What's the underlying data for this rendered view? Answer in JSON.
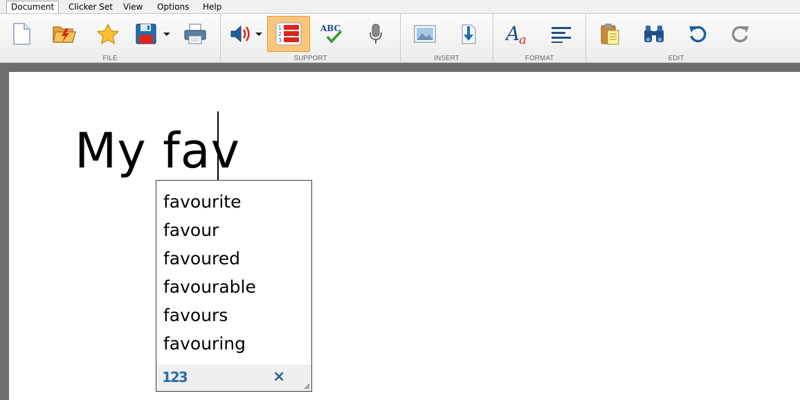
{
  "menu": {
    "tabs": [
      {
        "label": "Document"
      },
      {
        "label": "Clicker Set"
      },
      {
        "label": "View"
      },
      {
        "label": "Options"
      },
      {
        "label": "Help"
      }
    ]
  },
  "ribbon": {
    "groups": [
      {
        "label": "FILE"
      },
      {
        "label": "SUPPORT"
      },
      {
        "label": "INSERT"
      },
      {
        "label": "FORMAT"
      },
      {
        "label": "EDIT"
      }
    ],
    "colors": {
      "active_button": "#fbc67c",
      "accent_blue": "#2b6ea8",
      "accent_red": "#d9261c"
    }
  },
  "document": {
    "text": "My fav"
  },
  "prediction": {
    "words": [
      "favourite",
      "favour",
      "favoured",
      "favourable",
      "favours",
      "favouring"
    ],
    "number_icon_label": "123",
    "close_label": "×"
  }
}
